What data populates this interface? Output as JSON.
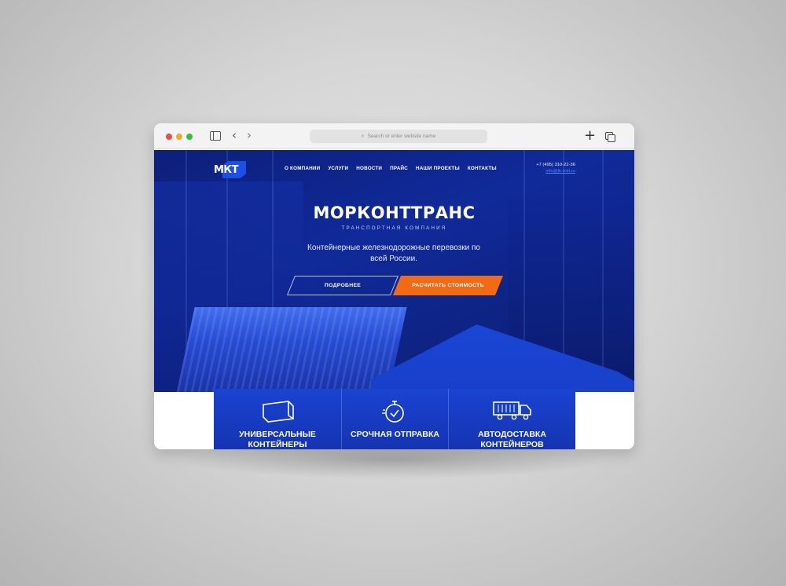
{
  "browser": {
    "url_placeholder": "Search or enter website name",
    "back": "‹",
    "forward": "›",
    "new_tab": "+",
    "icons": [
      "sidebar-icon",
      "search-icon",
      "plus-icon",
      "tabs-icon"
    ]
  },
  "site": {
    "logo": "МКТ",
    "nav": [
      "О КОМПАНИИ",
      "УСЛУГИ",
      "НОВОСТИ",
      "ПРАЙС",
      "НАШИ ПРОЕКТЫ",
      "КОНТАКТЫ"
    ],
    "phone": "+7 (495) 310-22-36",
    "email": "info@tk-mkt.ru"
  },
  "hero": {
    "title": "МОРКОНТТРАНС",
    "subtitle": "ТРАНСПОРТНАЯ КОМПАНИЯ",
    "tagline": "Контейнерные железнодорожные перевозки по всей России.",
    "button_more": "ПОДРОБНЕЕ",
    "button_calc": "РАСЧИТАТЬ СТОИМОСТЬ"
  },
  "features": [
    {
      "label": "УНИВЕРСАЛЬНЫЕ КОНТЕЙНЕРЫ",
      "icon": "container-icon"
    },
    {
      "label": "СРОЧНАЯ ОТПРАВКА",
      "icon": "stopwatch-icon"
    },
    {
      "label": "АВТОДОСТАВКА КОНТЕЙНЕРОВ",
      "icon": "truck-icon"
    }
  ],
  "colors": {
    "brand_blue": "#1a43d2",
    "accent_orange": "#f26a13",
    "hero_dark": "#0d1f7a"
  }
}
